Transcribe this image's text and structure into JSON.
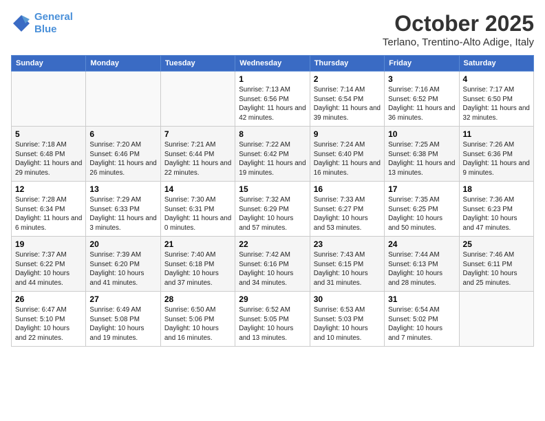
{
  "logo": {
    "line1": "General",
    "line2": "Blue"
  },
  "title": "October 2025",
  "location": "Terlano, Trentino-Alto Adige, Italy",
  "days_of_week": [
    "Sunday",
    "Monday",
    "Tuesday",
    "Wednesday",
    "Thursday",
    "Friday",
    "Saturday"
  ],
  "weeks": [
    [
      {
        "day": "",
        "info": ""
      },
      {
        "day": "",
        "info": ""
      },
      {
        "day": "",
        "info": ""
      },
      {
        "day": "1",
        "info": "Sunrise: 7:13 AM\nSunset: 6:56 PM\nDaylight: 11 hours and 42 minutes."
      },
      {
        "day": "2",
        "info": "Sunrise: 7:14 AM\nSunset: 6:54 PM\nDaylight: 11 hours and 39 minutes."
      },
      {
        "day": "3",
        "info": "Sunrise: 7:16 AM\nSunset: 6:52 PM\nDaylight: 11 hours and 36 minutes."
      },
      {
        "day": "4",
        "info": "Sunrise: 7:17 AM\nSunset: 6:50 PM\nDaylight: 11 hours and 32 minutes."
      }
    ],
    [
      {
        "day": "5",
        "info": "Sunrise: 7:18 AM\nSunset: 6:48 PM\nDaylight: 11 hours and 29 minutes."
      },
      {
        "day": "6",
        "info": "Sunrise: 7:20 AM\nSunset: 6:46 PM\nDaylight: 11 hours and 26 minutes."
      },
      {
        "day": "7",
        "info": "Sunrise: 7:21 AM\nSunset: 6:44 PM\nDaylight: 11 hours and 22 minutes."
      },
      {
        "day": "8",
        "info": "Sunrise: 7:22 AM\nSunset: 6:42 PM\nDaylight: 11 hours and 19 minutes."
      },
      {
        "day": "9",
        "info": "Sunrise: 7:24 AM\nSunset: 6:40 PM\nDaylight: 11 hours and 16 minutes."
      },
      {
        "day": "10",
        "info": "Sunrise: 7:25 AM\nSunset: 6:38 PM\nDaylight: 11 hours and 13 minutes."
      },
      {
        "day": "11",
        "info": "Sunrise: 7:26 AM\nSunset: 6:36 PM\nDaylight: 11 hours and 9 minutes."
      }
    ],
    [
      {
        "day": "12",
        "info": "Sunrise: 7:28 AM\nSunset: 6:34 PM\nDaylight: 11 hours and 6 minutes."
      },
      {
        "day": "13",
        "info": "Sunrise: 7:29 AM\nSunset: 6:33 PM\nDaylight: 11 hours and 3 minutes."
      },
      {
        "day": "14",
        "info": "Sunrise: 7:30 AM\nSunset: 6:31 PM\nDaylight: 11 hours and 0 minutes."
      },
      {
        "day": "15",
        "info": "Sunrise: 7:32 AM\nSunset: 6:29 PM\nDaylight: 10 hours and 57 minutes."
      },
      {
        "day": "16",
        "info": "Sunrise: 7:33 AM\nSunset: 6:27 PM\nDaylight: 10 hours and 53 minutes."
      },
      {
        "day": "17",
        "info": "Sunrise: 7:35 AM\nSunset: 6:25 PM\nDaylight: 10 hours and 50 minutes."
      },
      {
        "day": "18",
        "info": "Sunrise: 7:36 AM\nSunset: 6:23 PM\nDaylight: 10 hours and 47 minutes."
      }
    ],
    [
      {
        "day": "19",
        "info": "Sunrise: 7:37 AM\nSunset: 6:22 PM\nDaylight: 10 hours and 44 minutes."
      },
      {
        "day": "20",
        "info": "Sunrise: 7:39 AM\nSunset: 6:20 PM\nDaylight: 10 hours and 41 minutes."
      },
      {
        "day": "21",
        "info": "Sunrise: 7:40 AM\nSunset: 6:18 PM\nDaylight: 10 hours and 37 minutes."
      },
      {
        "day": "22",
        "info": "Sunrise: 7:42 AM\nSunset: 6:16 PM\nDaylight: 10 hours and 34 minutes."
      },
      {
        "day": "23",
        "info": "Sunrise: 7:43 AM\nSunset: 6:15 PM\nDaylight: 10 hours and 31 minutes."
      },
      {
        "day": "24",
        "info": "Sunrise: 7:44 AM\nSunset: 6:13 PM\nDaylight: 10 hours and 28 minutes."
      },
      {
        "day": "25",
        "info": "Sunrise: 7:46 AM\nSunset: 6:11 PM\nDaylight: 10 hours and 25 minutes."
      }
    ],
    [
      {
        "day": "26",
        "info": "Sunrise: 6:47 AM\nSunset: 5:10 PM\nDaylight: 10 hours and 22 minutes."
      },
      {
        "day": "27",
        "info": "Sunrise: 6:49 AM\nSunset: 5:08 PM\nDaylight: 10 hours and 19 minutes."
      },
      {
        "day": "28",
        "info": "Sunrise: 6:50 AM\nSunset: 5:06 PM\nDaylight: 10 hours and 16 minutes."
      },
      {
        "day": "29",
        "info": "Sunrise: 6:52 AM\nSunset: 5:05 PM\nDaylight: 10 hours and 13 minutes."
      },
      {
        "day": "30",
        "info": "Sunrise: 6:53 AM\nSunset: 5:03 PM\nDaylight: 10 hours and 10 minutes."
      },
      {
        "day": "31",
        "info": "Sunrise: 6:54 AM\nSunset: 5:02 PM\nDaylight: 10 hours and 7 minutes."
      },
      {
        "day": "",
        "info": ""
      }
    ]
  ]
}
